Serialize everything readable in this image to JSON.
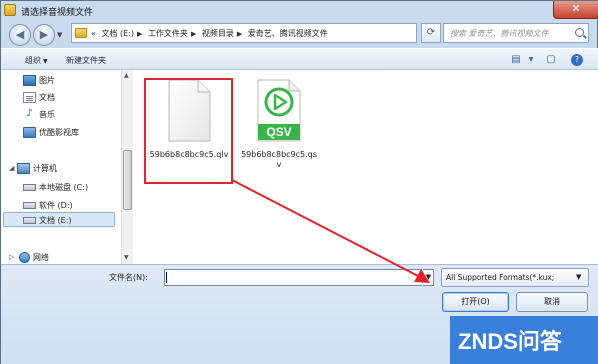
{
  "window": {
    "title": "请选择音视频文件",
    "close_label": "✕"
  },
  "address": {
    "crumbs": [
      "«",
      "文档 (E:)",
      "工作文件夹",
      "视频目录",
      "爱奇艺、腾讯视频文件"
    ],
    "search_placeholder": "搜索 爱奇艺、腾讯视频文件"
  },
  "toolbar": {
    "organize": "组织",
    "new_folder": "新建文件夹"
  },
  "nav": {
    "libraries": [
      "图片",
      "文档",
      "音乐",
      "优酷影视库"
    ],
    "computer": "计算机",
    "drives": [
      "本地磁盘 (C:)",
      "软件 (D:)",
      "文档 (E:)"
    ],
    "network": "网络"
  },
  "files": [
    {
      "name": "59b6b8c8bc9c5.qlv",
      "icon": "blank-file-icon"
    },
    {
      "name": "59b6b8c8bc9c5.qsv",
      "icon": "qsv-file-icon",
      "badge": "QSV"
    }
  ],
  "bottom": {
    "filename_label": "文件名(N):",
    "filename_value": "",
    "filter": "All Supported Formats(*.kux;",
    "open": "打开(O)",
    "cancel": "取消"
  },
  "watermark": "ZNDS问答",
  "colors": {
    "highlight": "#e0262b",
    "qsv_green": "#3bb54a",
    "watermark": "#3a7fd9"
  }
}
